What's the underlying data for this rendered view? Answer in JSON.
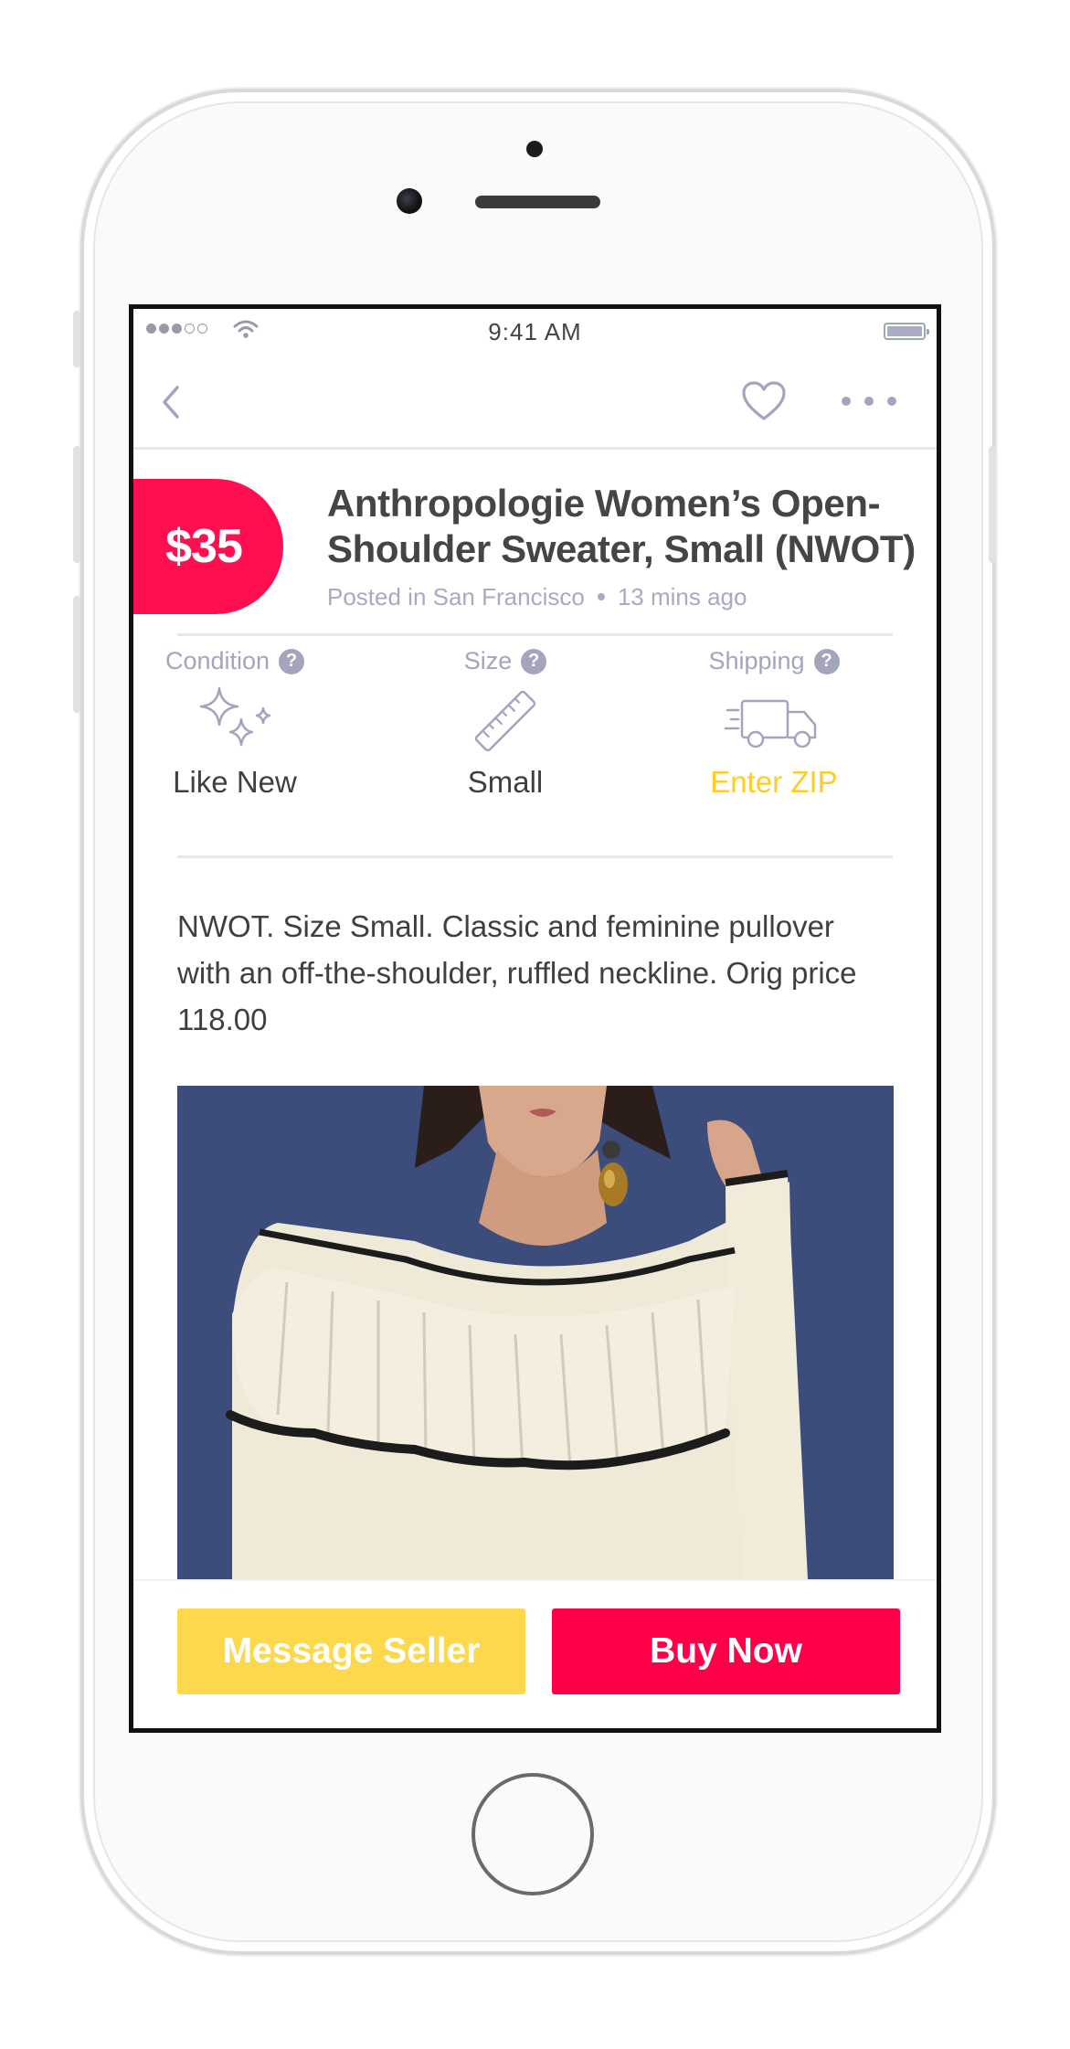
{
  "status_bar": {
    "time": "9:41 AM"
  },
  "listing": {
    "price": "$35",
    "title": "Anthropologie Women’s Open-Shoulder Sweater, Small (NWOT)",
    "location": "Posted in San Francisco",
    "posted_ago": "13 mins ago",
    "description": "NWOT. Size Small. Classic and feminine pullover with an off-the-shoulder, ruffled neckline. Orig price 118.00"
  },
  "attributes": {
    "condition": {
      "label": "Condition",
      "value": "Like New",
      "icon": "sparkles-icon"
    },
    "size": {
      "label": "Size",
      "value": "Small",
      "icon": "ruler-icon"
    },
    "shipping": {
      "label": "Shipping",
      "value": "Enter ZIP",
      "icon": "truck-icon"
    },
    "help_glyph": "?"
  },
  "actions": {
    "message_label": "Message Seller",
    "buy_label": "Buy Now"
  },
  "colors": {
    "accent_pink": "#ff0048",
    "accent_yellow": "#fdd84c",
    "muted_text": "#a3a5be"
  }
}
